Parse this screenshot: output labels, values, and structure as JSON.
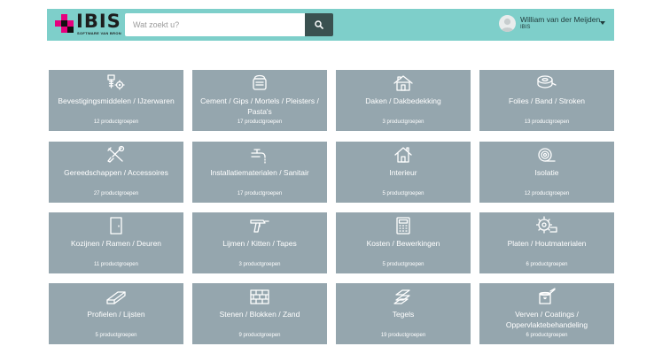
{
  "header": {
    "logo_text": "IBIS",
    "logo_subtext": "SOFTWARE VAN BRON",
    "search_placeholder": "Wat zoekt u?",
    "user_name": "William van der Meijden",
    "user_org": "IBIS",
    "accent_color": "#7ecfca"
  },
  "categories": [
    {
      "title": "Bevestigingsmiddelen / IJzerwaren",
      "count": "12 productgroepen",
      "icon": "screw-gear-icon"
    },
    {
      "title": "Cement / Gips / Mortels / Pleisters / Pasta's",
      "count": "17 productgroepen",
      "icon": "cement-bag-icon"
    },
    {
      "title": "Daken / Dakbedekking",
      "count": "3 productgroepen",
      "icon": "house-roof-icon"
    },
    {
      "title": "Folies / Band / Stroken",
      "count": "13 productgroepen",
      "icon": "tape-roll-icon"
    },
    {
      "title": "Gereedschappen / Accessoires",
      "count": "27 productgroepen",
      "icon": "tools-icon"
    },
    {
      "title": "Installatiematerialen / Sanitair",
      "count": "17 productgroepen",
      "icon": "faucet-icon"
    },
    {
      "title": "Interieur",
      "count": "5 productgroepen",
      "icon": "home-icon"
    },
    {
      "title": "Isolatie",
      "count": "12 productgroepen",
      "icon": "insulation-roll-icon"
    },
    {
      "title": "Kozijnen / Ramen / Deuren",
      "count": "11 productgroepen",
      "icon": "door-icon"
    },
    {
      "title": "Lijmen / Kitten / Tapes",
      "count": "3 productgroepen",
      "icon": "glue-gun-icon"
    },
    {
      "title": "Kosten / Bewerkingen",
      "count": "5 productgroepen",
      "icon": "calculator-icon"
    },
    {
      "title": "Platen / Houtmaterialen",
      "count": "6 productgroepen",
      "icon": "saw-blade-icon"
    },
    {
      "title": "Profielen / Lijsten",
      "count": "5 productgroepen",
      "icon": "profile-beam-icon"
    },
    {
      "title": "Stenen / Blokken / Zand",
      "count": "9 productgroepen",
      "icon": "bricks-icon"
    },
    {
      "title": "Tegels",
      "count": "19 productgroepen",
      "icon": "tiles-icon"
    },
    {
      "title": "Verven / Coatings / Oppervlaktebehandeling",
      "count": "6 productgroepen",
      "icon": "paint-can-icon"
    }
  ]
}
